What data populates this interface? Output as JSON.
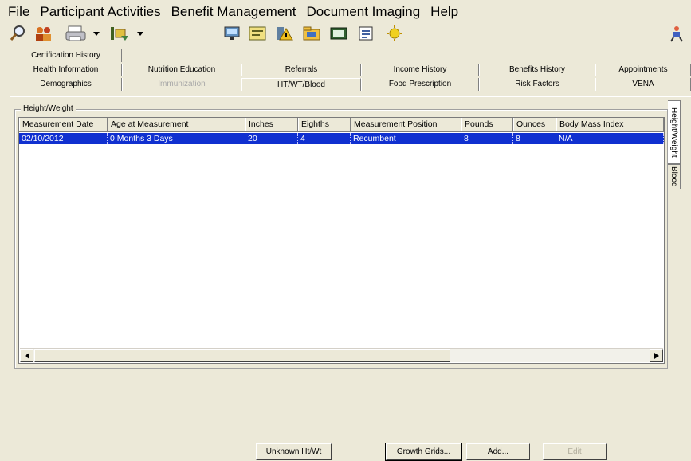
{
  "menu": [
    "File",
    "Participant Activities",
    "Benefit Management",
    "Document Imaging",
    "Help"
  ],
  "toolbar_icons": [
    "search-icon",
    "participants-icon",
    "printer-icon",
    "transfer-icon",
    "monitor-icon",
    "card-icon",
    "alert-icon",
    "folder-icon",
    "scanner-icon",
    "document-icon",
    "sun-icon",
    "help-figure-icon"
  ],
  "tabs": {
    "row1": [
      {
        "label": "Certification History"
      }
    ],
    "row2": [
      {
        "label": "Health Information"
      },
      {
        "label": "Nutrition Education"
      },
      {
        "label": "Referrals"
      },
      {
        "label": "Income History"
      },
      {
        "label": "Benefits History"
      },
      {
        "label": "Appointments"
      }
    ],
    "row3": [
      {
        "label": "Demographics"
      },
      {
        "label": "Immunization"
      },
      {
        "label": "HT/WT/Blood"
      },
      {
        "label": "Food Prescription"
      },
      {
        "label": "Risk Factors"
      },
      {
        "label": "VENA"
      }
    ]
  },
  "group_title": "Height/Weight",
  "table": {
    "columns": [
      "Measurement Date",
      "Age at Measurement",
      "Inches",
      "Eighths",
      "Measurement Position",
      "Pounds",
      "Ounces",
      "Body Mass Index"
    ],
    "rows": [
      [
        "02/10/2012",
        "0 Months 3 Days",
        "20",
        "4",
        "Recumbent",
        "8",
        "8",
        "N/A"
      ]
    ]
  },
  "side_tabs": [
    "Height/Weight",
    "Blood"
  ],
  "buttons": {
    "unknown": "Unknown Ht/Wt",
    "growth": "Growth Grids...",
    "add": "Add...",
    "edit": "Edit"
  },
  "colors": {
    "selection": "#1030d0",
    "background": "#ece9d8"
  }
}
